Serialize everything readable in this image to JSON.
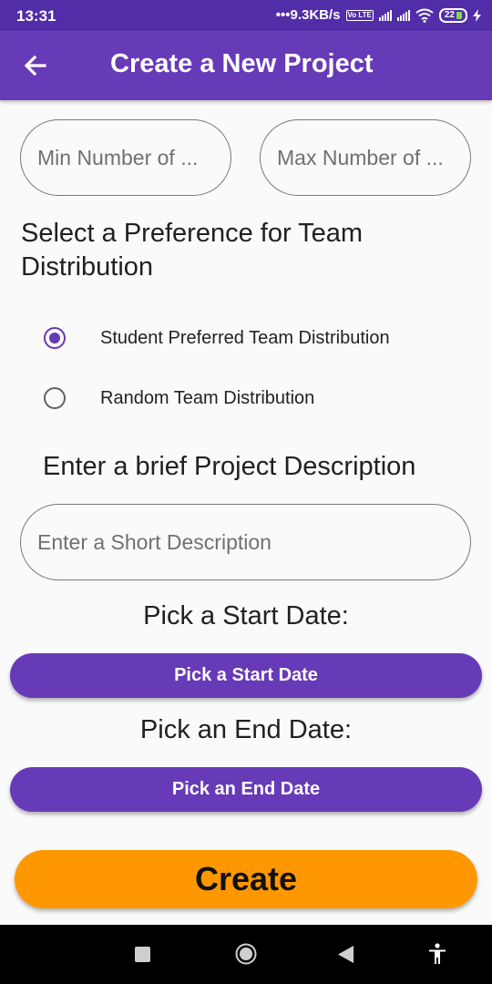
{
  "status_bar": {
    "time": "13:31",
    "network_speed": "•••9.3KB/s",
    "volte": "Vo LTE",
    "battery": "22",
    "icons": [
      "volte-icon",
      "signal-icon",
      "wifi-icon",
      "battery-icon",
      "charging-icon"
    ]
  },
  "app_bar": {
    "title": "Create a New Project",
    "back_icon": "arrow-left-icon"
  },
  "form": {
    "min_placeholder": "Min Number of ...",
    "max_placeholder": "Max Number of ...",
    "preference_heading": "Select a Preference for Team Distribution",
    "options": [
      {
        "label": "Student Preferred Team Distribution",
        "selected": true
      },
      {
        "label": "Random Team Distribution",
        "selected": false
      }
    ],
    "description_heading": "Enter a brief Project Description",
    "description_placeholder": "Enter a Short Description",
    "start_heading": "Pick a Start Date:",
    "start_button": "Pick a Start Date",
    "end_heading": "Pick an End Date:",
    "end_button": "Pick an End Date",
    "create_button": "Create"
  },
  "colors": {
    "primary": "#673ab7",
    "primary_dark": "#512da8",
    "accent": "#ff9800",
    "background": "#fafafa"
  },
  "nav_bar": {
    "icons": [
      "recents-icon",
      "home-icon",
      "back-icon",
      "accessibility-icon"
    ]
  }
}
